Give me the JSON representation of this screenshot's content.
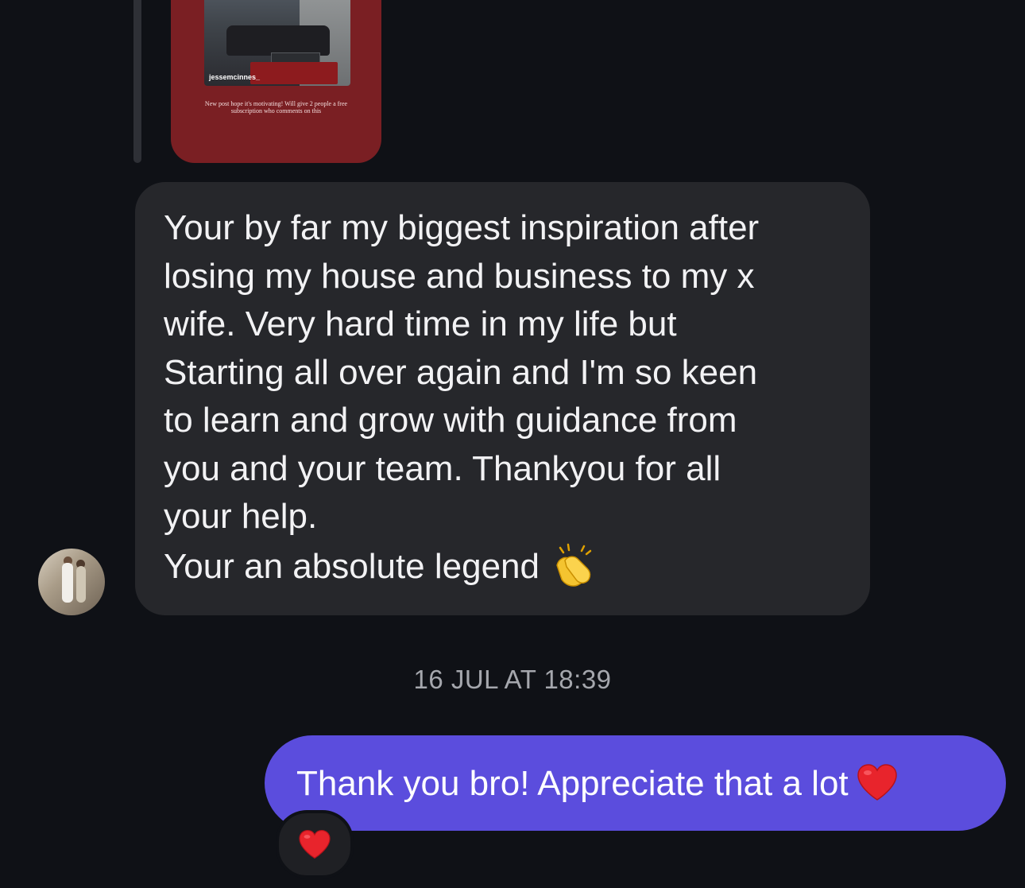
{
  "story_reply": {
    "username": "jessemcinnes_",
    "caption": "New post hope it's motivating! Will give 2 people a free subscription who comments on this"
  },
  "incoming_message": {
    "text": "Your by far my biggest inspiration after\nlosing my house and business to my x\nwife. Very hard time in my life but\nStarting all over again and I'm so keen\nto learn and grow with guidance from\nyou and your team. Thankyou for all\nyour help.\nYour an absolute legend",
    "emoji": "clapping-hands"
  },
  "timestamp": "16 JUL AT 18:39",
  "outgoing_message": {
    "text": "Thank you bro! Appreciate that a lot",
    "emoji": "red-heart"
  },
  "reaction": {
    "emoji": "red-heart"
  },
  "colors": {
    "background": "#0f1116",
    "incoming_bubble": "#26272b",
    "outgoing_bubble": "#5b4ddd",
    "story_card": "#7a1f23",
    "timestamp_text": "#a5a7ad"
  }
}
